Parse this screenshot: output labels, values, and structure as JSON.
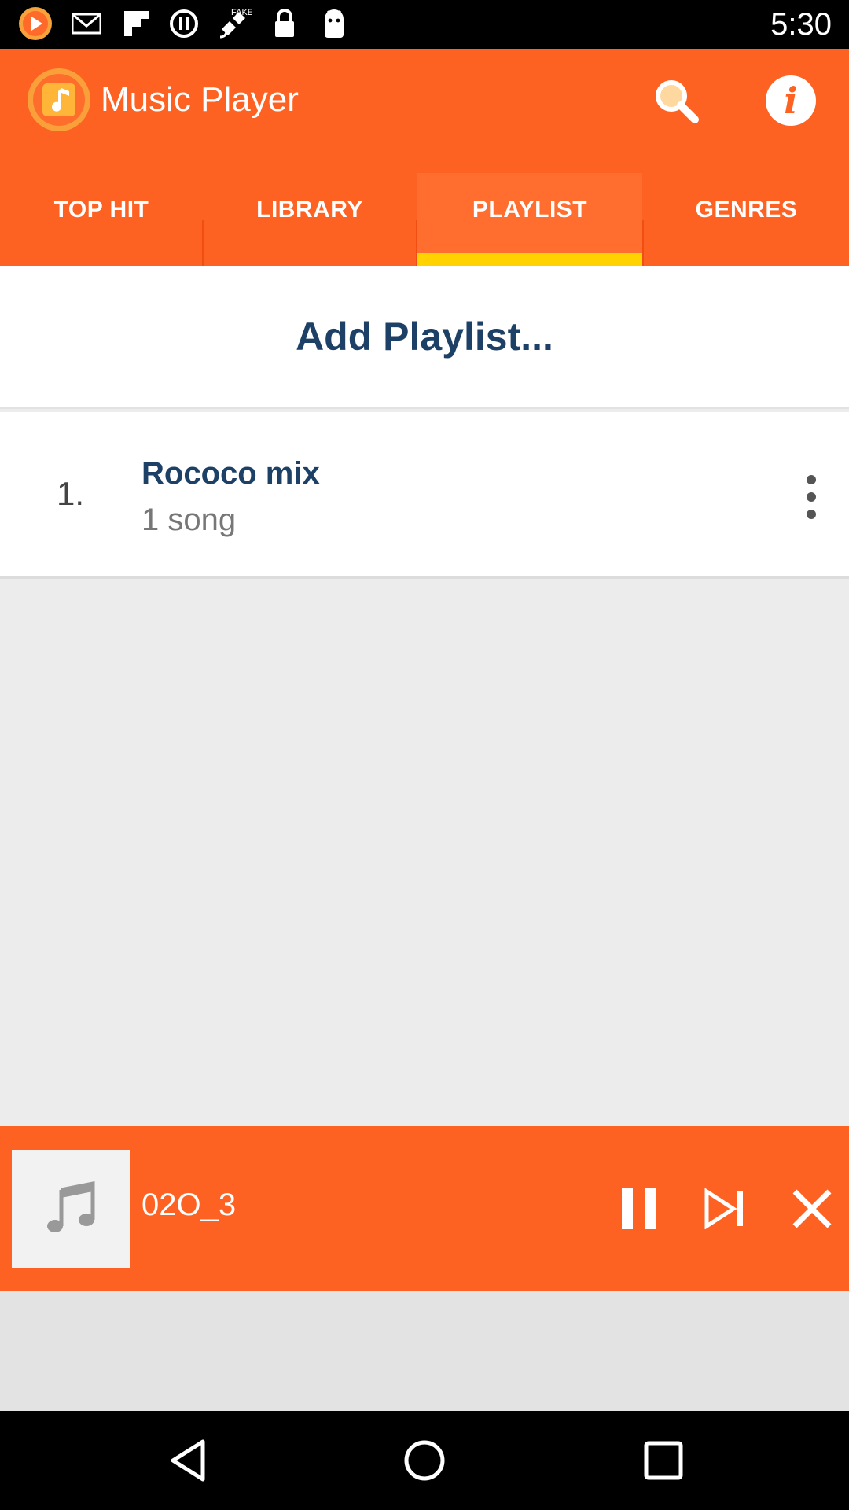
{
  "status_bar": {
    "time": "5:30",
    "icons": [
      "app-notification-icon",
      "mail-icon",
      "flipboard-icon",
      "pause-circle-icon",
      "satellite-icon",
      "lock-icon",
      "android-icon"
    ]
  },
  "app_bar": {
    "title": "Music Player",
    "logo_icon": "music-player-logo-icon",
    "search_icon": "search-icon",
    "info_icon": "info-icon",
    "info_glyph": "i"
  },
  "tabs": [
    {
      "label": "TOP HIT",
      "active": false
    },
    {
      "label": "LIBRARY",
      "active": false
    },
    {
      "label": "PLAYLIST",
      "active": true
    },
    {
      "label": "GENRES",
      "active": false
    }
  ],
  "content": {
    "add_playlist_label": "Add Playlist...",
    "playlists": [
      {
        "index": "1.",
        "name": "Rococo mix",
        "count": "1 song"
      }
    ]
  },
  "player": {
    "song_title": "02O_3",
    "art_icon": "music-note-icon",
    "controls": [
      "pause-icon",
      "skip-next-icon",
      "close-icon"
    ]
  },
  "nav_bar": [
    "back-icon",
    "home-icon",
    "recents-icon"
  ],
  "colors": {
    "accent": "#fe6223",
    "tab_indicator": "#ffd200",
    "title_text": "#1c4066"
  }
}
